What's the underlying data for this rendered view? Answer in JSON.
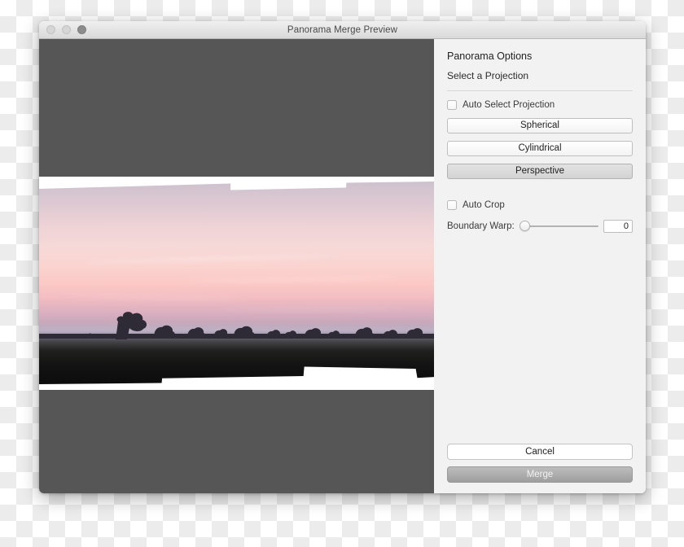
{
  "window": {
    "title": "Panorama Merge Preview",
    "traffic_lights": [
      "close-button",
      "minimize-button",
      "zoom-button"
    ]
  },
  "preview": {
    "alt": "Stitched panorama preview of a pink sunset over a field with tree silhouettes",
    "background_color": "#565656",
    "canvas_color": "#ffffff"
  },
  "panel": {
    "title": "Panorama Options",
    "subtitle": "Select a Projection",
    "auto_select": {
      "label": "Auto Select Projection",
      "checked": false
    },
    "projections": [
      {
        "label": "Spherical",
        "selected": false
      },
      {
        "label": "Cylindrical",
        "selected": false
      },
      {
        "label": "Perspective",
        "selected": true
      }
    ],
    "auto_crop": {
      "label": "Auto Crop",
      "checked": false
    },
    "boundary_warp": {
      "label": "Boundary Warp:",
      "value": "0",
      "min": "0",
      "max": "100"
    },
    "actions": {
      "cancel_label": "Cancel",
      "merge_label": "Merge"
    }
  },
  "colors": {
    "panel_background": "#f2f2f2",
    "preview_background": "#565656",
    "selected_button": "#d8d8d8",
    "merge_button": "#a8a8a8",
    "divider": "#d8d8d8"
  }
}
